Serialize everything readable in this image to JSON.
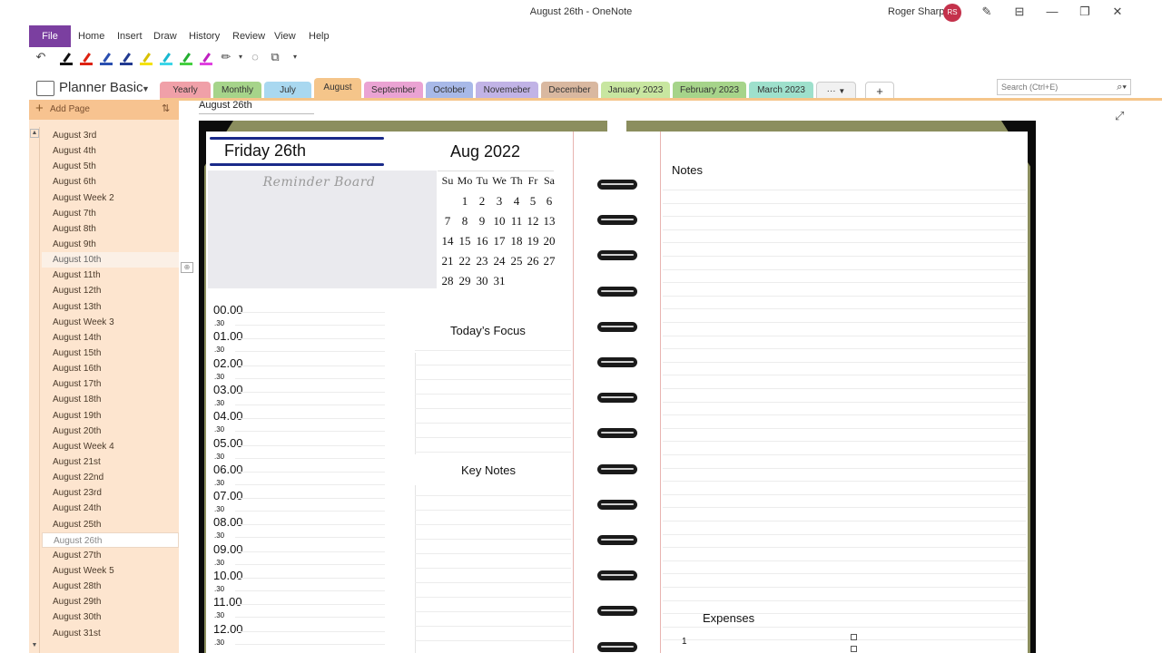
{
  "window": {
    "title": "August 26th  -  OneNote",
    "user": "Roger Sharp",
    "avatar_initials": "RS",
    "avatar_color": "#c4314b"
  },
  "menu": {
    "file": "File",
    "items": [
      "Home",
      "Insert",
      "Draw",
      "History",
      "Review",
      "View",
      "Help"
    ],
    "file_color": "#7b3fa0"
  },
  "notebook": {
    "name": "Planner Basic",
    "sections": [
      {
        "label": "Yearly",
        "color": "#f0a0a8"
      },
      {
        "label": "Monthly",
        "color": "#a6d48a"
      },
      {
        "label": "July",
        "color": "#a9d8f0"
      },
      {
        "label": "August",
        "color": "#f5c58a",
        "active": true
      },
      {
        "label": "September",
        "color": "#eaa3d3"
      },
      {
        "label": "October",
        "color": "#a8b9e8"
      },
      {
        "label": "Novemeber",
        "color": "#c1b3e6"
      },
      {
        "label": "December",
        "color": "#d9b8a0"
      },
      {
        "label": "January 2023",
        "color": "#c8e6a0"
      },
      {
        "label": "February 2023",
        "color": "#a6d48a"
      },
      {
        "label": "March 2023",
        "color": "#9ee0cc"
      },
      {
        "label": "···",
        "color": "#f1f1f1"
      },
      {
        "label": "+",
        "color": "#ffffff"
      }
    ],
    "search_placeholder": "Search (Ctrl+E)"
  },
  "pages": {
    "add_label": "Add Page",
    "list": [
      "August 3rd",
      "August 4th",
      "August 5th",
      "August 6th",
      "August Week 2",
      "August 7th",
      "August 8th",
      "August 9th",
      "August 10th",
      "August 11th",
      "August 12th",
      "August 13th",
      "August Week 3",
      "August 14th",
      "August 15th",
      "August 16th",
      "August 17th",
      "August 18th",
      "August 19th",
      "August 20th",
      "August Week 4",
      "August 21st",
      "August 22nd",
      "August 23rd",
      "August 24th",
      "August 25th",
      "August 26th",
      "August 27th",
      "August Week 5",
      "August 28th",
      "August 29th",
      "August 30th",
      "August 31st"
    ],
    "hover_index": 8,
    "selected_index": 26
  },
  "page": {
    "title": "August 26th"
  },
  "planner": {
    "day_heading": "Friday 26th",
    "reminder_title": "Reminder Board",
    "month_heading": "Aug 2022",
    "calendar": {
      "weekdays": [
        "Su",
        "Mo",
        "Tu",
        "We",
        "Th",
        "Fr",
        "Sa"
      ],
      "weeks": [
        [
          "",
          "1",
          "2",
          "3",
          "4",
          "5",
          "6"
        ],
        [
          "7",
          "8",
          "9",
          "10",
          "11",
          "12",
          "13"
        ],
        [
          "14",
          "15",
          "16",
          "17",
          "18",
          "19",
          "20"
        ],
        [
          "21",
          "22",
          "23",
          "24",
          "25",
          "26",
          "27"
        ],
        [
          "28",
          "29",
          "30",
          "31",
          "",
          "",
          ""
        ]
      ]
    },
    "hours": [
      "00.00",
      "01.00",
      "02.00",
      "03.00",
      "04.00",
      "05.00",
      "06.00",
      "07.00",
      "08.00",
      "09.00",
      "10.00",
      "11.00",
      "12.00"
    ],
    "half_label": ".30",
    "focus_title": "Today’s Focus",
    "key_notes_title": "Key Notes",
    "notes_title": "Notes",
    "expenses_title": "Expenses",
    "expense_first_index": "1",
    "colors": {
      "cover": "#8b8e5e",
      "ink": "#1a2a8a",
      "board": "#eaeaee"
    }
  }
}
